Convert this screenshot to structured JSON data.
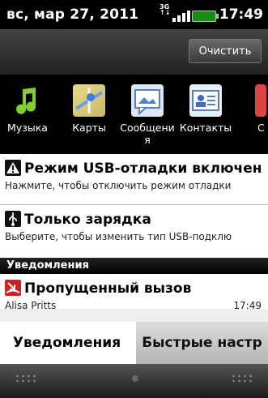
{
  "status_bar": {
    "date": "вс, мар 27, 2011",
    "network": "3G",
    "time": "17:49"
  },
  "clear_button": "Очистить",
  "apps": [
    {
      "label": "Музыка",
      "icon": "music-note-icon"
    },
    {
      "label": "Карты",
      "icon": "maps-icon"
    },
    {
      "label": "Сообщени я",
      "icon": "messages-icon"
    },
    {
      "label": "Контакты",
      "icon": "contacts-icon"
    },
    {
      "label": "С",
      "icon": "partial-app-icon"
    }
  ],
  "notifications": [
    {
      "title": "Режим USB-отладки включен",
      "subtitle": "Нажмите, чтобы отключить режим отладки ",
      "icon": "warning-icon"
    },
    {
      "title": "Только зарядка",
      "subtitle": "Выберите, чтобы изменить тип USB-подклю",
      "icon": "usb-icon"
    }
  ],
  "section_header": "Уведомления",
  "missed_call": {
    "title": "Пропущенный вызов",
    "caller": "Alisa Pritts",
    "time": "17:49",
    "icon": "missed-call-icon"
  },
  "tabs": {
    "notifications": "Уведомления",
    "quick_settings": "Быстрые настр"
  }
}
